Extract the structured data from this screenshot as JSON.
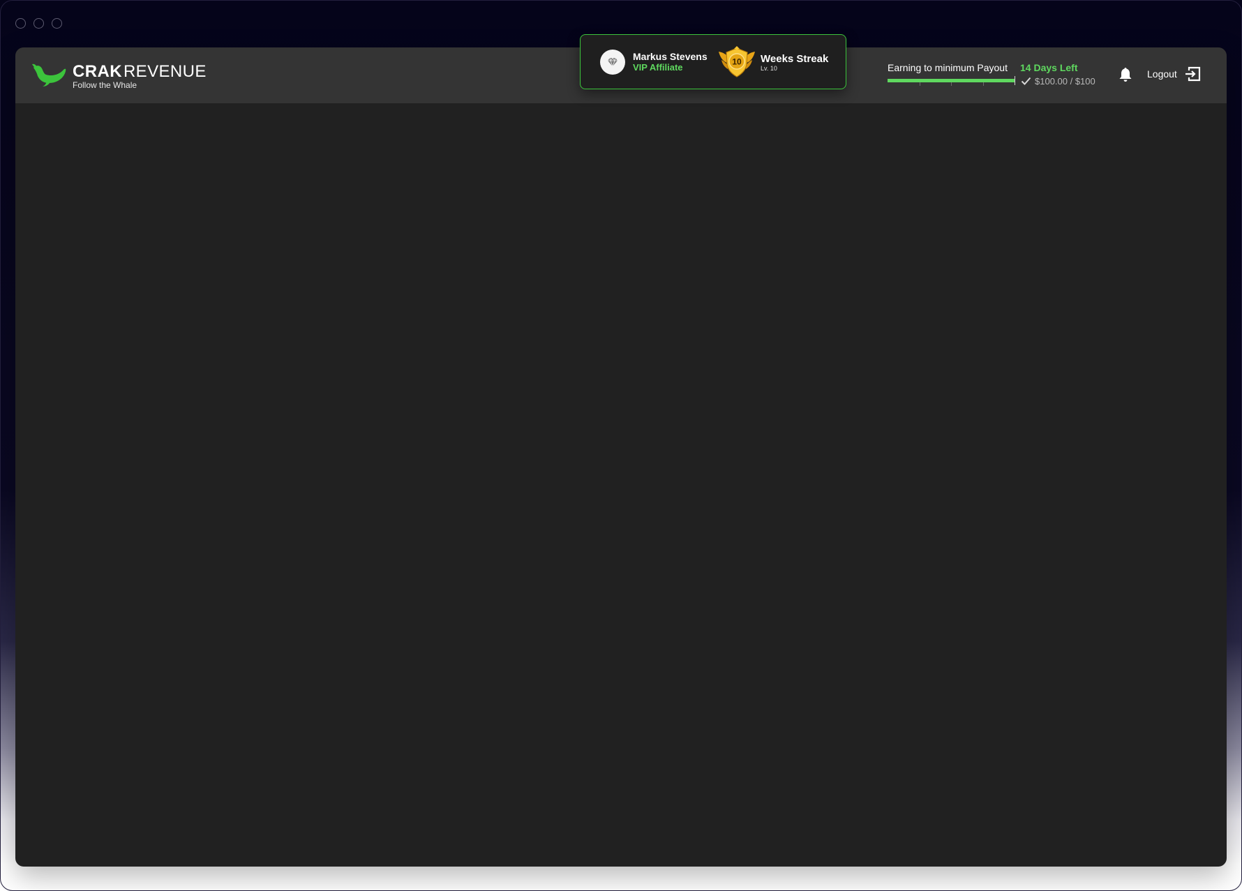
{
  "brand": {
    "name_bold": "CRAK",
    "name_regular": "REVENUE",
    "tagline": "Follow the Whale",
    "accent": "#3cc43c"
  },
  "profile": {
    "name": "Markus Stevens",
    "tier": "VIP Affiliate",
    "avatar_icon": "diamond-icon"
  },
  "streak": {
    "badge_number": "10",
    "title": "Weeks Streak",
    "level": "Lv. 10",
    "badge_icon": "winged-shield-badge-icon"
  },
  "payout": {
    "label": "Earning to minimum Payout",
    "days_left": "14 Days Left",
    "amount": "$100.00 / $100",
    "progress_fraction": 1.0
  },
  "header_actions": {
    "notifications_icon": "bell-icon",
    "logout_label": "Logout",
    "logout_icon": "logout-icon"
  },
  "colors": {
    "app_background": "#212121",
    "header_background": "#343434",
    "accent_green": "#5fd85f"
  }
}
